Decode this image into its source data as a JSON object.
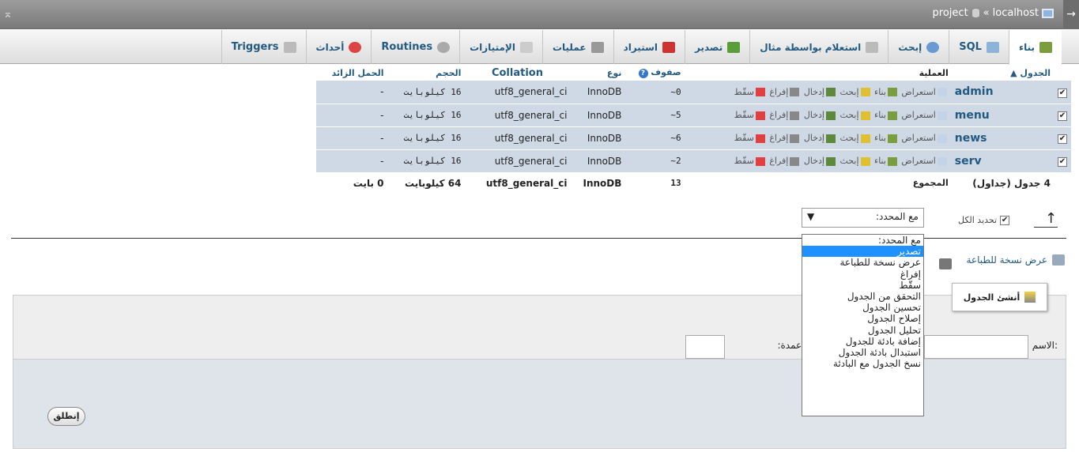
{
  "breadcrumb": {
    "server": "localhost",
    "sep": "«",
    "db": "project"
  },
  "tabs": [
    {
      "label": "بناء",
      "active": true
    },
    {
      "label": "SQL"
    },
    {
      "label": "إبحث"
    },
    {
      "label": "استعلام بواسطة مثال"
    },
    {
      "label": "تصدير"
    },
    {
      "label": "استيراد"
    },
    {
      "label": "عمليات"
    },
    {
      "label": "الإمتيازات"
    },
    {
      "label": "Routines"
    },
    {
      "label": "أحداث"
    },
    {
      "label": "Triggers"
    }
  ],
  "table_headers": {
    "table": "الجدول",
    "action": "العملية",
    "rows": "صفوف",
    "type": "نوع",
    "collation": "Collation",
    "size": "الحجم",
    "overhead": "الحمل الزائد"
  },
  "ops": {
    "browse": "استعراض",
    "structure": "بناء",
    "search": "إبحث",
    "insert": "إدخال",
    "empty": "إفراغ",
    "drop": "سقّط"
  },
  "rows": [
    {
      "name": "admin",
      "rows": "0~",
      "type": "InnoDB",
      "collation": "utf8_general_ci",
      "size": "16 كيلوبايت",
      "overhead": "-"
    },
    {
      "name": "menu",
      "rows": "5~",
      "type": "InnoDB",
      "collation": "utf8_general_ci",
      "size": "16 كيلوبايت",
      "overhead": "-"
    },
    {
      "name": "news",
      "rows": "6~",
      "type": "InnoDB",
      "collation": "utf8_general_ci",
      "size": "16 كيلوبايت",
      "overhead": "-"
    },
    {
      "name": "serv",
      "rows": "2~",
      "type": "InnoDB",
      "collation": "utf8_general_ci",
      "size": "16 كيلوبايت",
      "overhead": "-"
    }
  ],
  "summary": {
    "count": "4 جدول (جداول)",
    "label": "المجموع",
    "rows": "13",
    "type": "InnoDB",
    "collation": "utf8_general_ci",
    "size": "64 كيلوبايت",
    "overhead": "0 بايت"
  },
  "check_all": "تحديد الكل",
  "with_selected": "مع المحدد:",
  "dropdown_options": [
    "مع المحدد:",
    "تصدير",
    "عرض نسخة للطباعة",
    "إفراغ",
    "سقّط",
    "التحقق من الجدول",
    "تحسين الجدول",
    "إصلاح الجدول",
    "تحليل الجدول",
    "إضافة بادئة للجدول",
    "استبدال بادئة الجدول",
    "نسخ الجدول مع البادئة"
  ],
  "print_view": "عرض نسخة للطباعة",
  "create_table": "أنشئ الجدول",
  "name_label": "الاسم:",
  "columns_label": "عدد الأعمدة:",
  "go": "إنطلق"
}
